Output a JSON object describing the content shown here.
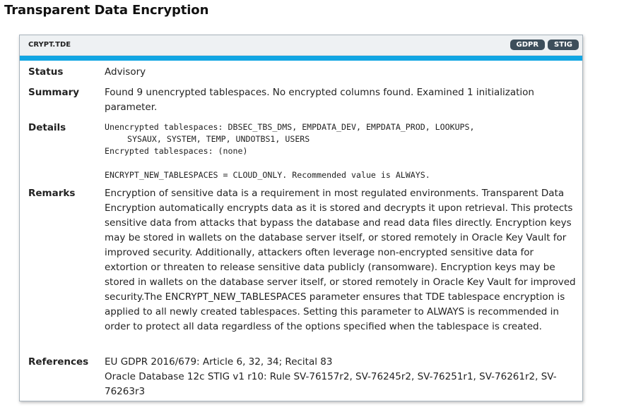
{
  "page": {
    "title": "Transparent Data Encryption"
  },
  "card": {
    "rule_id": "CRYPT.TDE",
    "badges": [
      "GDPR",
      "STIG"
    ],
    "accent_color": "#11a6e3",
    "badge_color": "#3d4e5b"
  },
  "fields": {
    "status_label": "Status",
    "status_value": "Advisory",
    "summary_label": "Summary",
    "summary_value": "Found 9 unencrypted tablespaces. No encrypted columns found. Examined 1 initialization parameter.",
    "details_label": "Details",
    "details_lines": [
      "Unencrypted tablespaces: DBSEC_TBS_DMS, EMPDATA_DEV, EMPDATA_PROD, LOOKUPS,",
      "SYSAUX, SYSTEM, TEMP, UNDOTBS1, USERS",
      "Encrypted tablespaces: (none)",
      "ENCRYPT_NEW_TABLESPACES = CLOUD_ONLY. Recommended value is ALWAYS."
    ],
    "remarks_label": "Remarks",
    "remarks_value": "Encryption of sensitive data is a requirement in most regulated environments. Transparent Data Encryption automatically encrypts data as it is stored and decrypts it upon retrieval. This protects sensitive data from attacks that bypass the database and read data files directly. Encryption keys may be stored in wallets on the database server itself, or stored remotely in Oracle Key Vault for improved security. Additionally, attackers often leverage non-encrypted sensitive data for extortion or threaten to release sensitive data publicly (ransomware). Encryption keys may be stored in wallets on the database server itself, or stored remotely in Oracle Key Vault for improved security.The ENCRYPT_NEW_TABLESPACES parameter ensures that TDE tablespace encryption is applied to all newly created tablespaces. Setting this parameter to ALWAYS is recommended in order to protect all data regardless of the options specified when the tablespace is created.",
    "references_label": "References",
    "references": [
      "EU GDPR 2016/679: Article 6, 32, 34; Recital 83",
      "Oracle Database 12c STIG v1 r10: Rule SV-76157r2, SV-76245r2, SV-76251r1, SV-76261r2, SV-76263r3"
    ]
  }
}
